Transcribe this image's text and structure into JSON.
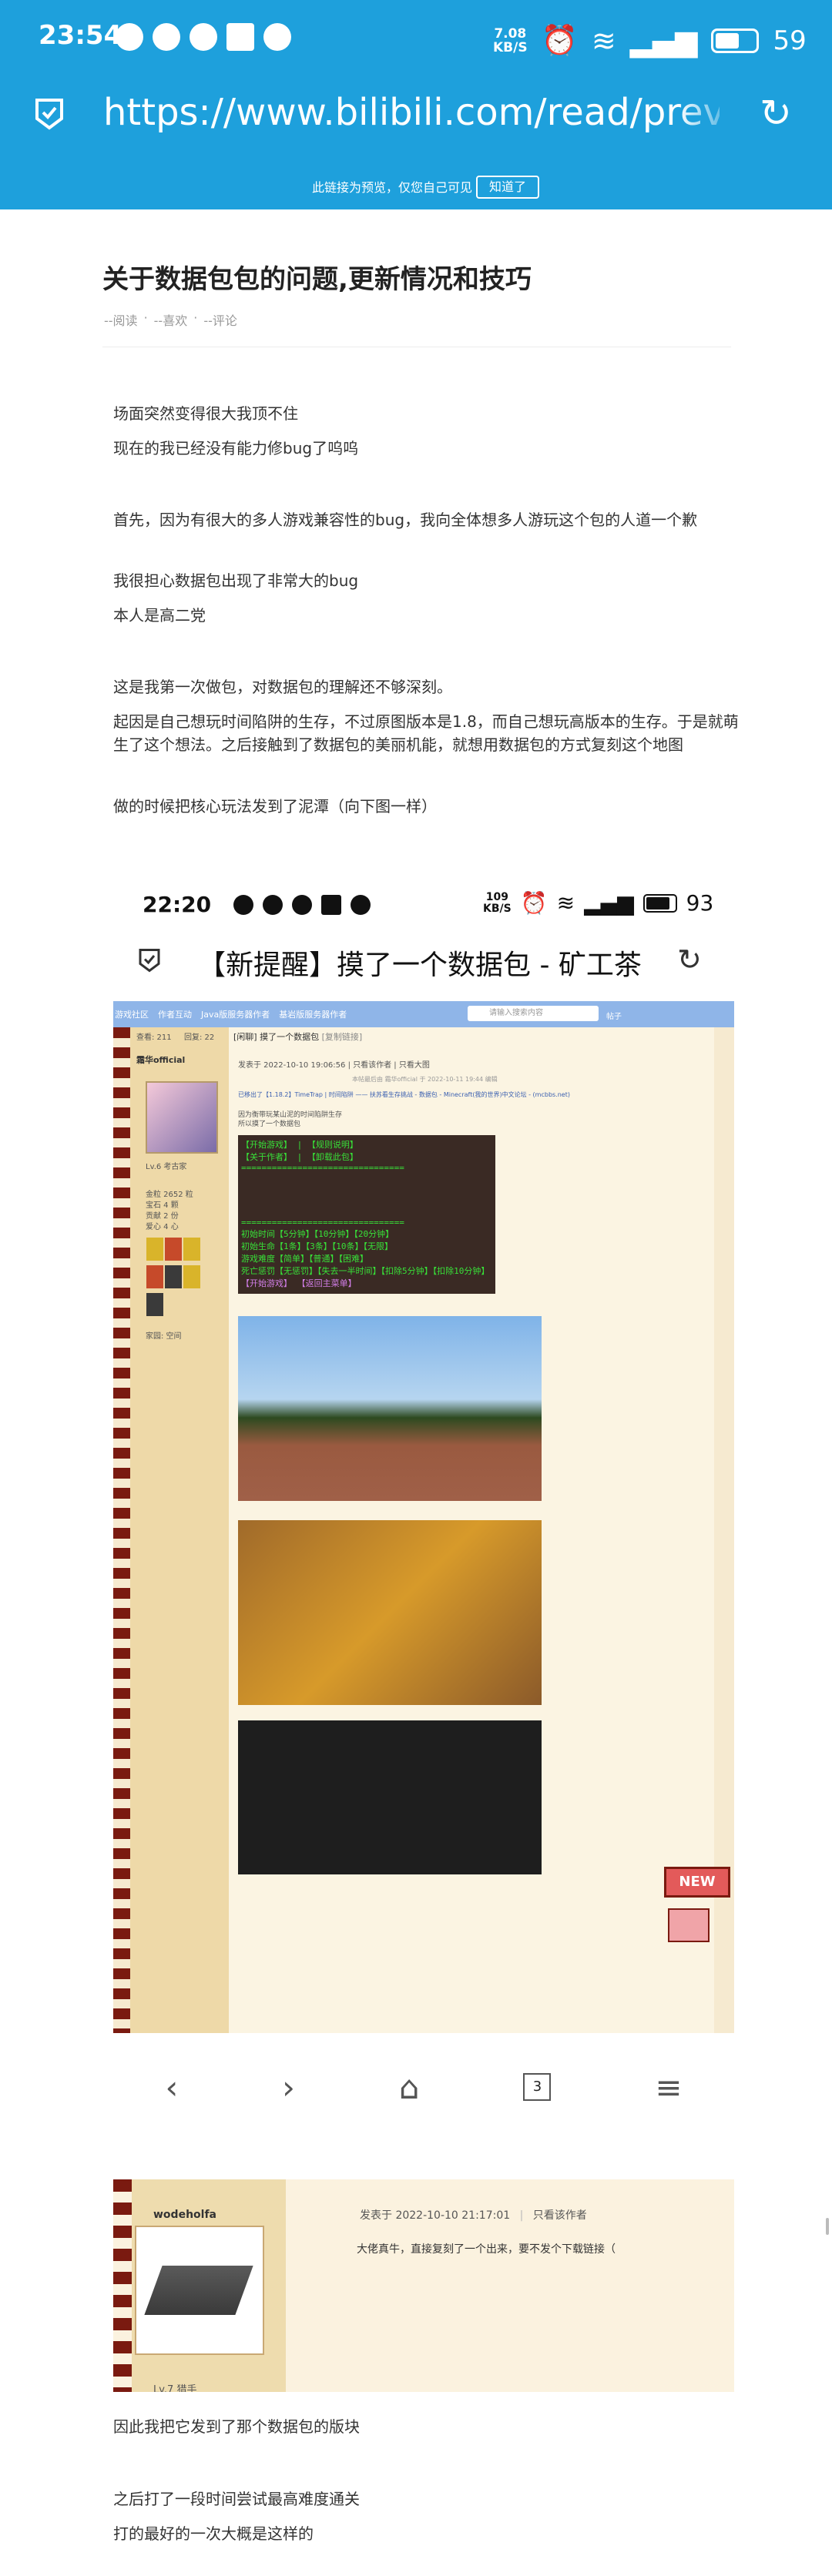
{
  "status_bar": {
    "time": "23:54",
    "speed_value": "7.08",
    "speed_unit": "KB/S",
    "battery": "59"
  },
  "url_bar": {
    "url": "https://www.bilibili.com/read/previe"
  },
  "preview_banner": {
    "text": "此链接为预览，仅您自己可见",
    "button": "知道了"
  },
  "article": {
    "title": "关于数据包包的问题,更新情况和技巧",
    "stats": [
      "--阅读",
      "--喜欢",
      "--评论"
    ],
    "paragraphs": [
      "场面突然变得很大我顶不住",
      "现在的我已经没有能力修bug了呜呜",
      "首先，因为有很大的多人游戏兼容性的bug，我向全体想多人游玩这个包的人道一个歉",
      "我很担心数据包出现了非常大的bug",
      "本人是高二党",
      "这是我第一次做包，对数据包的理解还不够深刻。",
      "起因是自己想玩时间陷阱的生存，不过原图版本是1.8，而自己想玩高版本的生存。于是就萌生了这个想法。之后接触到了数据包的美丽机能，就想用数据包的方式复刻这个地图",
      "做的时候把核心玩法发到了泥潭（向下图一样）",
      "因此我把它发到了那个数据包的版块",
      "之后打了一段时间尝试最高难度通关",
      "打的最好的一次大概是这样的"
    ]
  },
  "screenshot": {
    "status_time": "22:20",
    "status_speed_value": "109",
    "status_speed_unit": "KB/S",
    "status_battery": "93",
    "page_title": "【新提醒】摸了一个数据包 - 矿工茶",
    "forum": {
      "nav": [
        "游戏社区",
        "作者互动",
        "Java版服务器作者",
        "基岩版服务器作者"
      ],
      "search_placeholder": "请输入搜索内容",
      "search_scope": "帖子",
      "thread_title": "[闲聊] 摸了一个数据包",
      "thread_copy": "[复制链接]",
      "views_label": "查看: 211",
      "replies_label": "回复: 22",
      "username": "霜华official",
      "post_meta": "发表于 2022-10-10 19:06:56 | 只看该作者 | 只看大图",
      "edit_note": "本帖最后由 霜华official 于 2022-10-11 19:44 编辑",
      "linked_post": "已移出了【1.18.2】TimeTrap | 时间陷阱 —— 扶苏看生存挑战 - 数据包 - Minecraft(我的世界)中文论坛 - (mcbbs.net)",
      "body_lines": [
        "因为衡带玩某山泥的时间陷阱生存",
        "所以摸了一个数据包"
      ],
      "level": "Lv.6 考古家",
      "stats": [
        "金粒  2652 粒",
        "宝石  4 颗",
        "贡献  2 份",
        "爱心  4 心"
      ],
      "home_label": "家园: 空间",
      "terminal_lines": [
        "【开始游戏】  |  【规则说明】",
        "【关于作者】  |  【卸载此包】",
        "================================",
        "================================",
        "初始时间【5分钟】【10分钟】【20分钟】",
        "初始生命【1条】【3条】【10条】【无限】",
        "游戏难度【简单】【普通】【困难】",
        "死亡惩罚【无惩罚】【失去一半时间】【扣除5分钟】【扣除10分钟】",
        "【开始游戏】           【返回主菜单】",
        "================================"
      ],
      "tag_new": "NEW"
    },
    "toolbar": {
      "back": "‹",
      "forward": "›",
      "home": "⌂",
      "tabs": "3",
      "menu": "≡"
    }
  },
  "reply_snippet": {
    "username": "wodeholfa",
    "post_meta": "发表于 2022-10-10 21:17:01",
    "author_only": "只看该作者",
    "content": "大佬真牛，直接复刻了一个出来，要不发个下载链接（",
    "level": "Lv.7 猎手"
  },
  "icons": {
    "url_shield": "shield-icon",
    "reload": "reload-icon",
    "accent": "#1ea0dc"
  }
}
